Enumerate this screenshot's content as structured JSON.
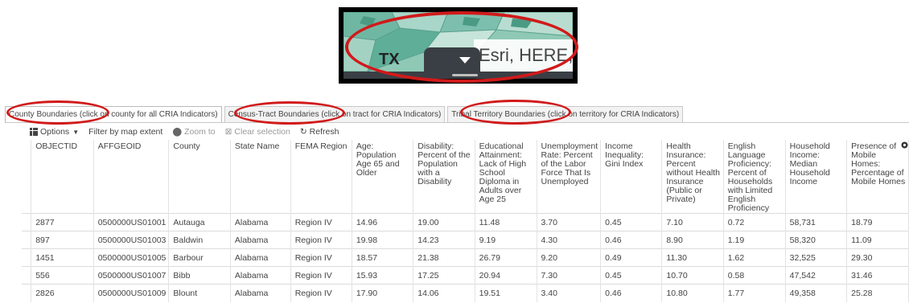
{
  "inset": {
    "state_label": "TX",
    "attribution": "Esri, HERE,"
  },
  "tabs": [
    "County Boundaries (click on county for all CRIA Indicators)",
    "Census-Tract Boundaries (click on tract for CRIA Indicators)",
    "Tribal Territory Boundaries (click on territory for CRIA Indicators)"
  ],
  "toolbar": {
    "options": "Options",
    "filter": "Filter by map extent",
    "zoom": "Zoom to",
    "clear": "Clear selection",
    "refresh": "Refresh"
  },
  "table": {
    "columns": [
      "OBJECTID",
      "AFFGEOID",
      "County",
      "State Name",
      "FEMA Region",
      "Age: Population Age 65 and Older",
      "Disability: Percent of the Population with a Disability",
      "Educational Attainment: Lack of High School Diploma in Adults over Age 25",
      "Unemployment Rate: Percent of the Labor Force That Is Unemployed",
      "Income Inequality: Gini Index",
      "Health Insurance: Percent without Health Insurance (Public or Private)",
      "English Language Proficiency: Percent of Households with Limited English Proficiency",
      "Household Income: Median Household Income",
      "Presence of Mobile Homes: Percentage of Mobile Homes"
    ],
    "rows": [
      [
        "2877",
        "0500000US01001",
        "Autauga",
        "Alabama",
        "Region IV",
        "14.96",
        "19.00",
        "11.48",
        "3.70",
        "0.45",
        "7.10",
        "0.72",
        "58,731",
        "18.79"
      ],
      [
        "897",
        "0500000US01003",
        "Baldwin",
        "Alabama",
        "Region IV",
        "19.98",
        "14.23",
        "9.19",
        "4.30",
        "0.46",
        "8.90",
        "1.19",
        "58,320",
        "11.09"
      ],
      [
        "1451",
        "0500000US01005",
        "Barbour",
        "Alabama",
        "Region IV",
        "18.57",
        "21.38",
        "26.79",
        "9.20",
        "0.49",
        "11.30",
        "1.62",
        "32,525",
        "29.30"
      ],
      [
        "556",
        "0500000US01007",
        "Bibb",
        "Alabama",
        "Region IV",
        "15.93",
        "17.25",
        "20.94",
        "7.30",
        "0.45",
        "10.70",
        "0.58",
        "47,542",
        "31.46"
      ],
      [
        "2826",
        "0500000US01009",
        "Blount",
        "Alabama",
        "Region IV",
        "17.90",
        "14.06",
        "19.51",
        "3.40",
        "0.46",
        "10.80",
        "1.77",
        "49,358",
        "25.28"
      ]
    ]
  },
  "colors": {
    "highlight_ellipse": "#d11a1a",
    "map_water_land": "#8fc9b6",
    "panel_dark": "#3a3f45"
  }
}
